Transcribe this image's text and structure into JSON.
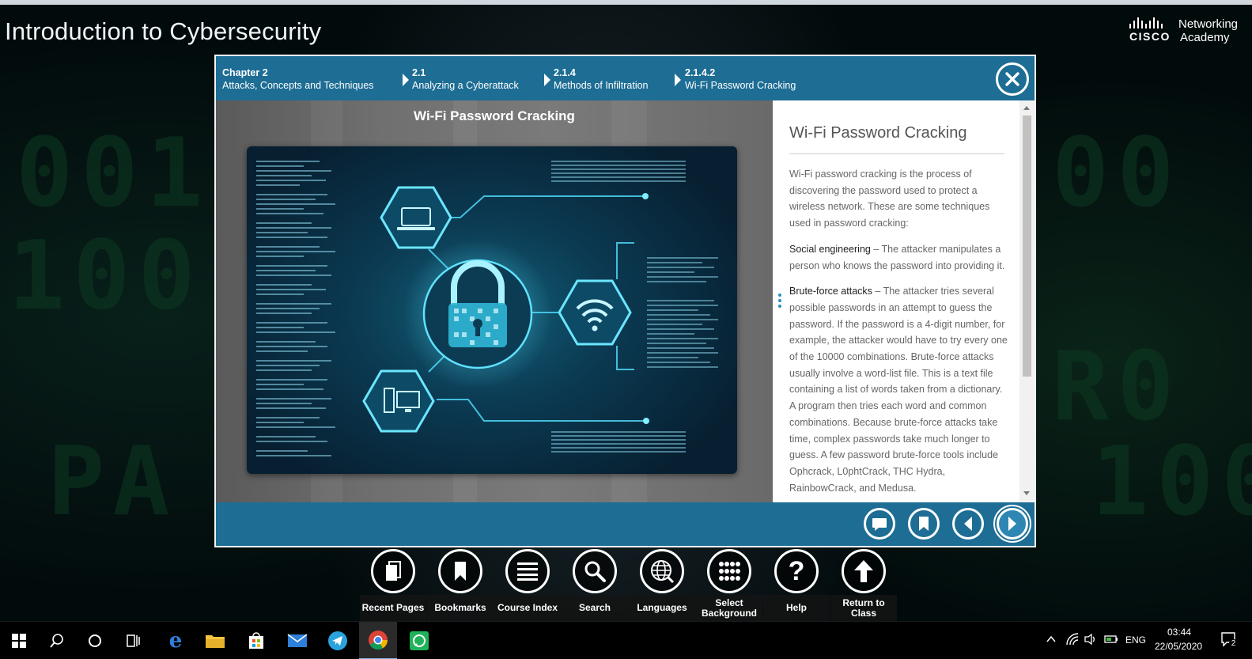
{
  "app": {
    "title": "Introduction to Cybersecurity",
    "brand_cisco": "CISCO",
    "brand_networking": "Networking",
    "brand_academy": "Academy"
  },
  "breadcrumb": [
    {
      "num": "Chapter 2",
      "label": "Attacks, Concepts and Techniques"
    },
    {
      "num": "2.1",
      "label": "Analyzing a Cyberattack"
    },
    {
      "num": "2.1.4",
      "label": "Methods of Infiltration"
    },
    {
      "num": "2.1.4.2",
      "label": "Wi-Fi Password Cracking"
    }
  ],
  "media": {
    "title": "Wi-Fi Password Cracking"
  },
  "article": {
    "title": "Wi-Fi Password Cracking",
    "intro": "Wi-Fi password cracking is the process of discovering the password used to protect a wireless network. These are some techniques used in password cracking:",
    "items": [
      {
        "term": "Social engineering",
        "text": " – The attacker manipulates a person who knows the password into providing it."
      },
      {
        "term": "Brute-force attacks",
        "text": " – The attacker tries several possible passwords in an attempt to guess the password. If the password is a 4-digit number, for example, the attacker would have to try every one of the 10000 combinations. Brute-force attacks usually involve a word-list file. This is a text file containing a list of words taken from a dictionary. A program then tries each word and common combinations. Because brute-force attacks take time, complex passwords take much longer to guess. A few password brute-force tools include Ophcrack, L0phtCrack, THC Hydra, RainbowCrack, and Medusa."
      }
    ]
  },
  "footer_buttons": [
    {
      "icon": "comment-icon"
    },
    {
      "icon": "bookmark-icon"
    },
    {
      "icon": "previous-icon"
    },
    {
      "icon": "next-icon"
    }
  ],
  "toolbar": [
    {
      "label": "Recent Pages",
      "icon": "recent-pages-icon"
    },
    {
      "label": "Bookmarks",
      "icon": "bookmarks-icon"
    },
    {
      "label": "Course Index",
      "icon": "course-index-icon"
    },
    {
      "label": "Search",
      "icon": "search-icon"
    },
    {
      "label": "Languages",
      "icon": "globe-icon"
    },
    {
      "label": "Select Background",
      "icon": "grid-dots-icon"
    },
    {
      "label": "Help",
      "icon": "help-icon"
    },
    {
      "label": "Return to Class",
      "icon": "arrow-up-icon"
    }
  ],
  "taskbar": {
    "language": "ENG",
    "time": "03:44",
    "date": "22/05/2020",
    "notification_count": "2"
  }
}
